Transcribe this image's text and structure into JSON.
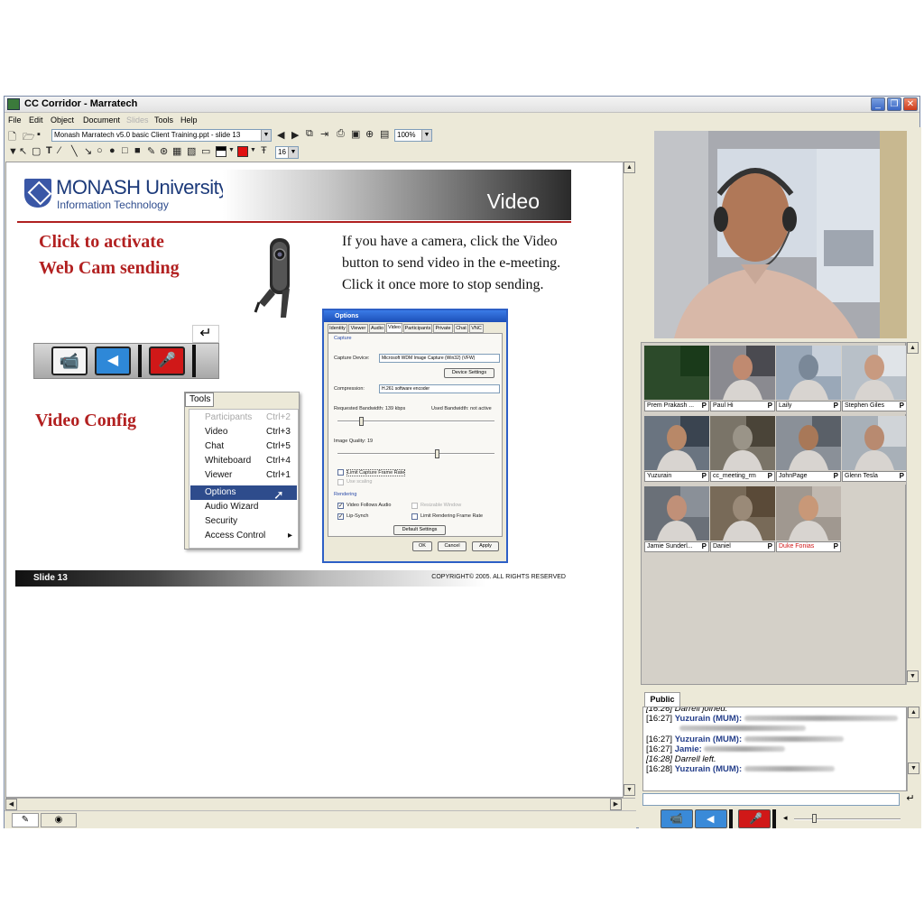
{
  "window": {
    "title": "CC Corridor - Marratech"
  },
  "menubar": [
    "File",
    "Edit",
    "Object",
    "Document",
    "Slides",
    "Tools",
    "Help"
  ],
  "toolbar": {
    "document_combo": "Monash Marratech v5.0 basic Client Training.ppt - slide 13",
    "zoom_combo": "100%",
    "font_size_combo": "16"
  },
  "slide": {
    "university_name": "MONASH University",
    "department": "Information Technology",
    "heading": "Video",
    "activate_text_line1": "Click to activate",
    "activate_text_line2": "Web Cam sending",
    "instructions_line1": "If you have a camera, click the Video",
    "instructions_line2": "button to send video in the e-meeting.",
    "instructions_line3": "Click it once more to stop sending.",
    "video_config": "Video Config",
    "slide_label": "Slide 13",
    "copyright": "COPYRIGHT© 2005. ALL RIGHTS RESERVED"
  },
  "tools_menu": {
    "header": "Tools",
    "items": [
      {
        "label": "Participants",
        "shortcut": "Ctrl+2",
        "disabled": true
      },
      {
        "label": "Video",
        "shortcut": "Ctrl+3"
      },
      {
        "label": "Chat",
        "shortcut": "Ctrl+5"
      },
      {
        "label": "Whiteboard",
        "shortcut": "Ctrl+4"
      },
      {
        "label": "Viewer",
        "shortcut": "Ctrl+1"
      },
      {
        "label": "Options",
        "shortcut": "",
        "selected": true
      },
      {
        "label": "Audio Wizard",
        "shortcut": ""
      },
      {
        "label": "Security",
        "shortcut": ""
      },
      {
        "label": "Access Control",
        "shortcut": "▸"
      }
    ]
  },
  "options_dialog": {
    "title": "Options",
    "tabs": [
      "Identity",
      "Viewer",
      "Audio",
      "Video",
      "Participants",
      "Private",
      "Chat",
      "VNC"
    ],
    "active_tab": "Video",
    "capture_group": "Capture",
    "capture_device_label": "Capture Device:",
    "capture_device_value": "Microsoft WDM Image Capture (Win32) (VFW)",
    "device_settings": "Device Settings",
    "compression_label": "Compression:",
    "compression_value": "H.261 software encoder",
    "requested_bandwidth": "Requested Bandwidth: 139 kbps",
    "used_bandwidth": "Used Bandwidth: not active",
    "bandwidth_level": 0.14,
    "image_quality": "Image Quality: 19",
    "image_quality_level": 0.62,
    "limit_capture": "Limit Capture Frame Rate",
    "use_scaling": "Use scaling",
    "rendering_group": "Rendering",
    "video_follows_audio": "Video Follows Audio",
    "resizable_window": "Resizable Window",
    "lip_synch": "Lip-Synch",
    "limit_rendering": "Limit Rendering Frame Rate",
    "default_settings": "Default Settings",
    "ok": "OK",
    "cancel": "Cancel",
    "apply": "Apply"
  },
  "participants": [
    {
      "name": "Prem Prakash ...",
      "flag": "P"
    },
    {
      "name": "Paul Hi",
      "flag": "P"
    },
    {
      "name": "Laily",
      "flag": "P"
    },
    {
      "name": "Stephen Giles",
      "flag": "P"
    },
    {
      "name": "Yuzurain",
      "flag": "P"
    },
    {
      "name": "cc_meeting_rm",
      "flag": "P"
    },
    {
      "name": "JohnPage",
      "flag": "P"
    },
    {
      "name": "Glenn Tesla",
      "flag": "P"
    },
    {
      "name": "Jamie Sunderl...",
      "flag": "P"
    },
    {
      "name": "Daniel",
      "flag": "P"
    },
    {
      "name": "Duke Fonias",
      "flag": "P",
      "highlight": true
    }
  ],
  "chat": {
    "tab": "Public",
    "lines": [
      {
        "time": "[16:26]",
        "text": "Darrell joined.",
        "italic": true
      },
      {
        "time": "[16:27]",
        "nick": "Yuzurain (MUM):"
      },
      {
        "time": "[16:27]",
        "nick": "Yuzurain (MUM):"
      },
      {
        "time": "[16:27]",
        "nick": "Jamie:"
      },
      {
        "time": "[16:28]",
        "text": "Darrell left.",
        "italic": true
      },
      {
        "time": "[16:28]",
        "nick": "Yuzurain (MUM):"
      }
    ]
  },
  "colors": {
    "accent_red": "#b22020",
    "monash_blue": "#1c3a7a",
    "selection": "#2e4c8c"
  }
}
